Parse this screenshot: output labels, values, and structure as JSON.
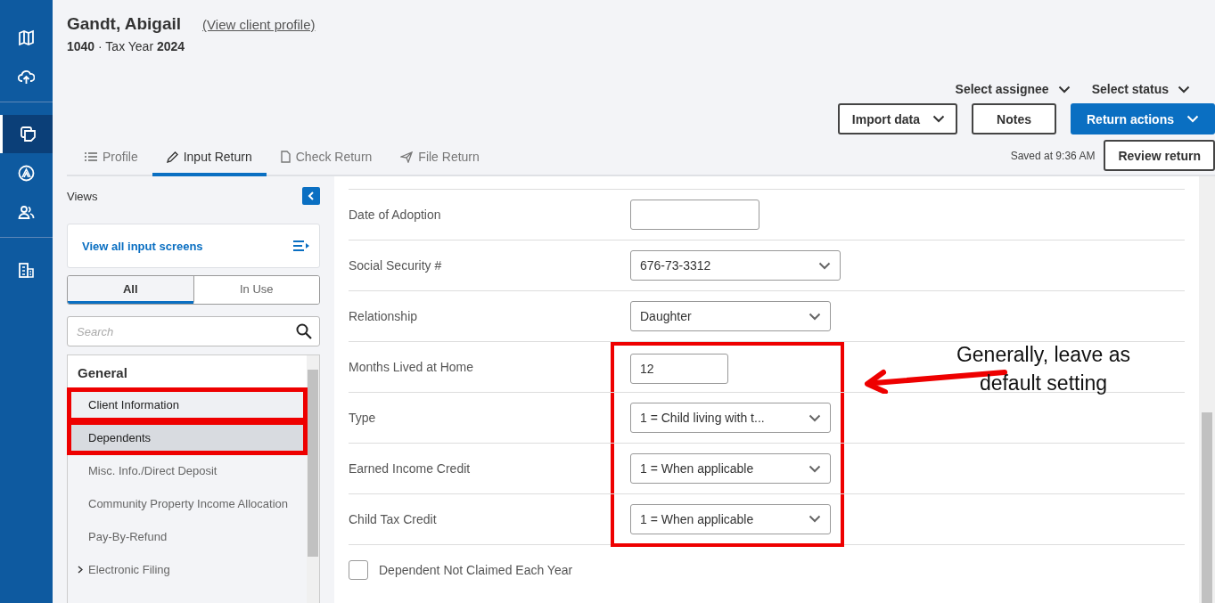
{
  "rail": {
    "items": [
      {
        "selected": false
      },
      {
        "selected": false
      },
      {
        "selected": true
      },
      {
        "selected": false
      },
      {
        "selected": false
      },
      {
        "selected": false
      }
    ]
  },
  "header": {
    "client_name": "Gandt, Abigail",
    "profile_link": "(View client profile)",
    "subtitle": "**1040** · Tax Year **2024**",
    "dropdowns": [
      "Select assignee",
      "Select status"
    ],
    "buttons": [
      {
        "label": "Import data",
        "kind": "dropdown"
      },
      {
        "label": "Notes",
        "kind": "plain"
      },
      {
        "label": "Return actions",
        "kind": "primary"
      }
    ]
  },
  "tabs": [
    {
      "label": "Profile",
      "selected": false
    },
    {
      "label": "Input Return",
      "selected": true
    },
    {
      "label": "Check Return",
      "selected": false
    },
    {
      "label": "File Return",
      "selected": false
    }
  ],
  "saved_text": "Saved at 9:36 AM",
  "review_button": "Review return",
  "sidebar": {
    "title": "Views",
    "view_all": "View all input screens",
    "segments": [
      {
        "label": "All",
        "selected": true
      },
      {
        "label": "In Use",
        "selected": false
      }
    ],
    "search": {
      "placeholder": "Search"
    },
    "group": "General",
    "items": [
      {
        "label": "Client Information",
        "selected": false,
        "highlighted": true,
        "expandable": false
      },
      {
        "label": "Dependents",
        "selected": true,
        "highlighted": true,
        "expandable": false
      },
      {
        "label": "Misc. Info./Direct Deposit",
        "selected": false,
        "highlighted": false,
        "expandable": false
      },
      {
        "label": "Community Property Income Allocation",
        "selected": false,
        "highlighted": false,
        "expandable": false
      },
      {
        "label": "Pay-By-Refund",
        "selected": false,
        "highlighted": false,
        "expandable": false
      },
      {
        "label": "Electronic Filing",
        "selected": false,
        "highlighted": false,
        "expandable": true
      }
    ]
  },
  "form": {
    "fields": [
      {
        "label": "Date of Adoption",
        "kind": "input",
        "highlighted": false
      },
      {
        "label": "Social Security #",
        "kind": "wide-select",
        "value": "676-73-3312",
        "highlighted": false
      },
      {
        "label": "Relationship",
        "kind": "select",
        "value": "Daughter",
        "highlighted": false
      },
      {
        "label": "Months Lived at Home",
        "kind": "short-input",
        "value": "12",
        "highlighted": true
      },
      {
        "label": "Type",
        "kind": "select",
        "value": "1 = Child living with t...",
        "highlighted": true
      },
      {
        "label": "Earned Income Credit",
        "kind": "select",
        "value": "1 = When applicable",
        "highlighted": true
      },
      {
        "label": "Child Tax Credit",
        "kind": "select",
        "value": "1 = When applicable",
        "highlighted": true
      },
      {
        "label": "Dependent Not Claimed Each Year",
        "kind": "checkbox",
        "checked": false,
        "highlighted": false
      }
    ]
  },
  "annotation": {
    "callout": "Generally, leave as default setting"
  }
}
